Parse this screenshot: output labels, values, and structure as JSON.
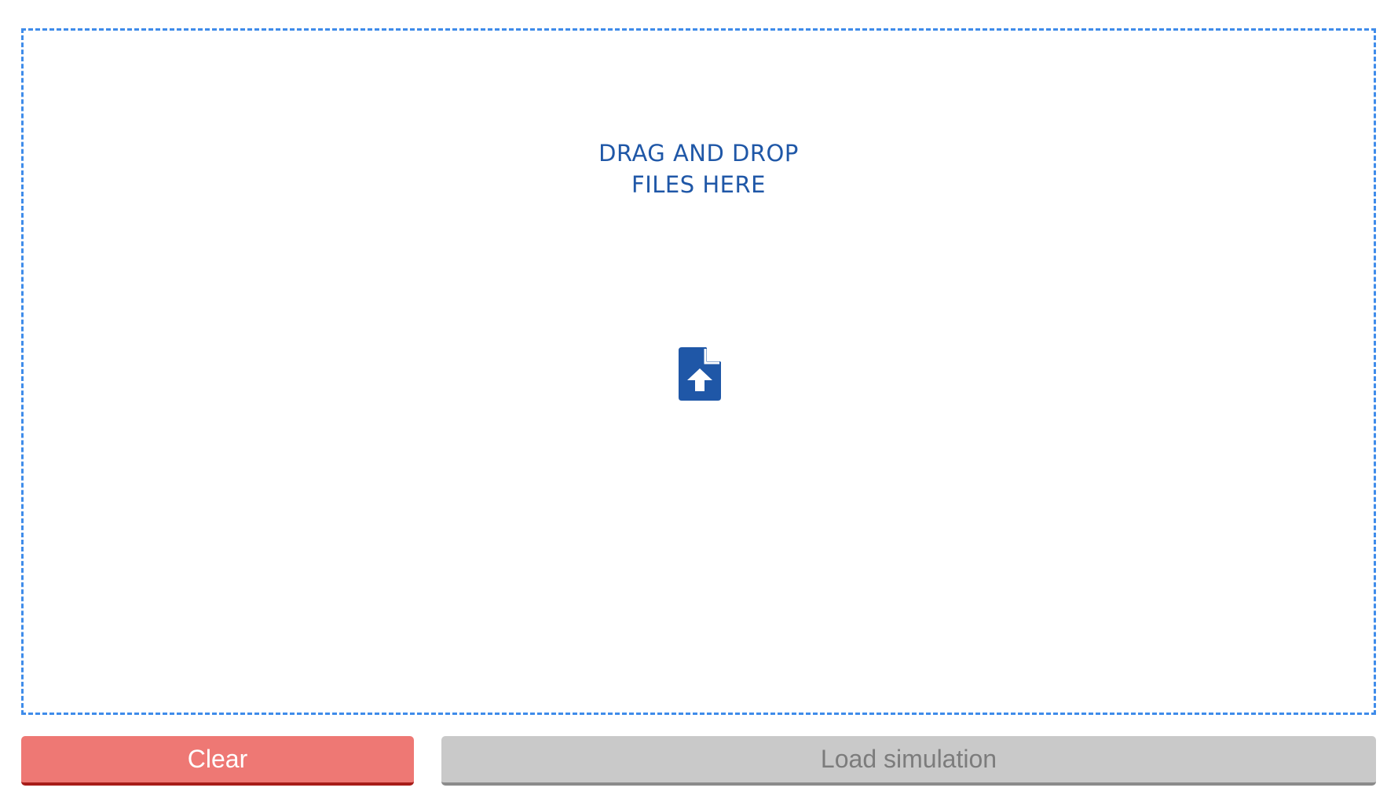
{
  "dropzone": {
    "title_line1": "DRAG AND DROP",
    "title_line2": "FILES HERE",
    "icon": "file-upload-icon",
    "border_color": "#3f8cea",
    "text_color": "#1f57a7"
  },
  "actions": {
    "clear_label": "Clear",
    "clear_color": "#ee7874",
    "load_label": "Load simulation",
    "load_color": "#c9c9c9",
    "load_disabled": true
  }
}
